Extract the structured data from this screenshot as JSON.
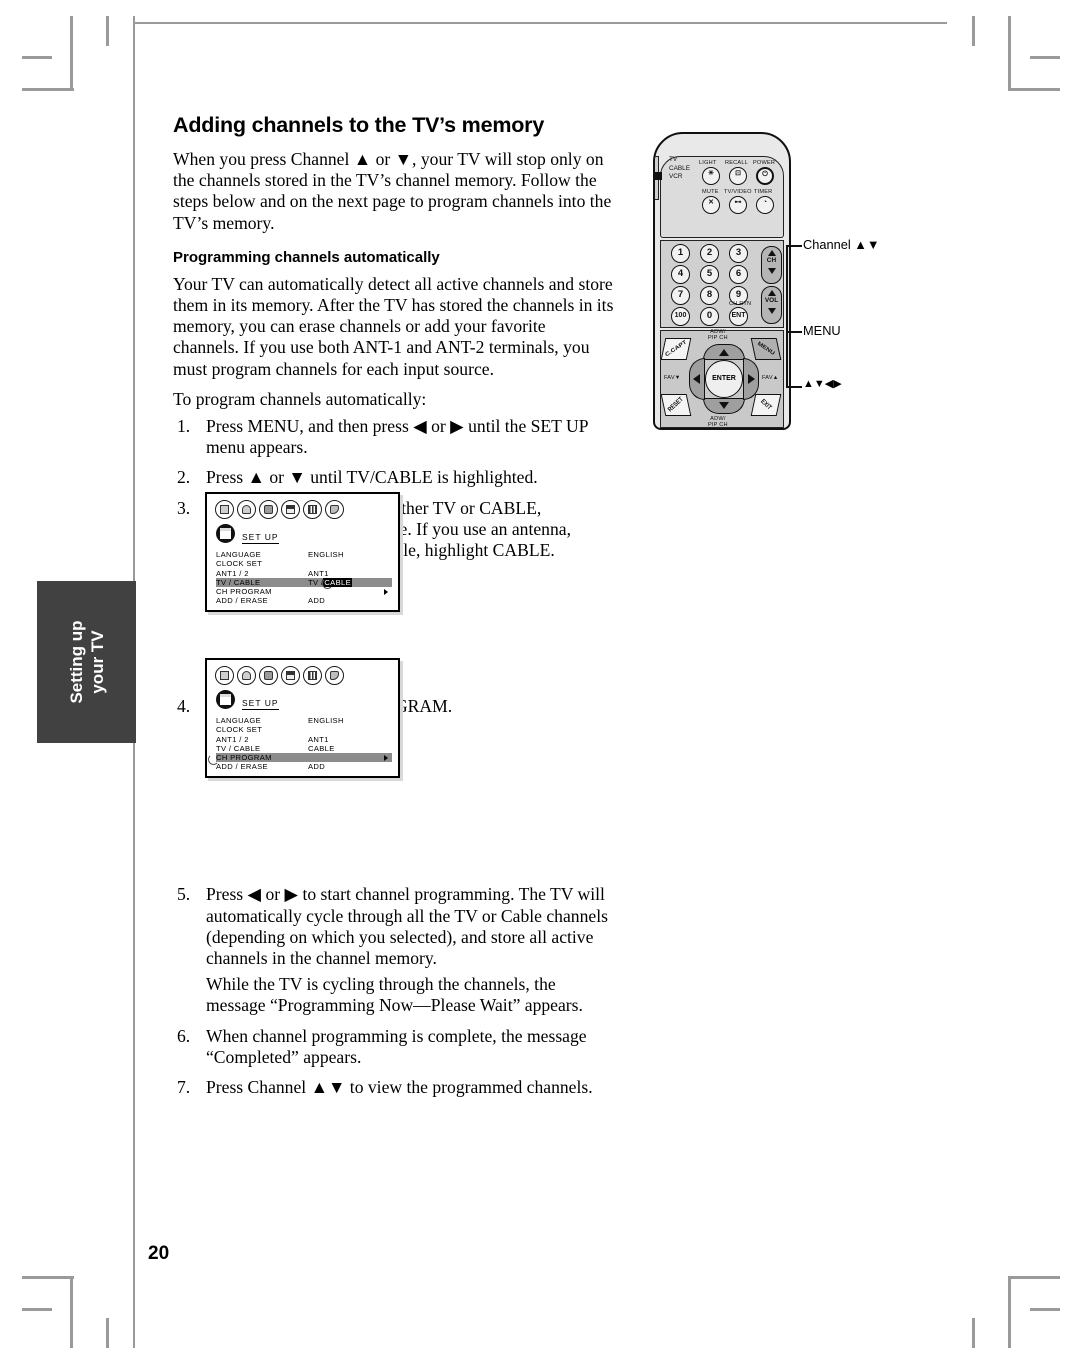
{
  "page": {
    "number": "20",
    "side_tab": "Setting up\nyour TV",
    "side_tab_line1": "Setting up",
    "side_tab_line2": "your TV"
  },
  "content": {
    "title": "Adding channels to the TV’s memory",
    "intro": "When you press Channel ▲ or ▼, your TV will stop only on the channels stored in the TV’s channel memory. Follow the steps below and on the next page to program channels into the TV’s memory.",
    "subtitle": "Programming channels automatically",
    "paragraph": "Your TV can automatically detect all active channels and store them in its memory. After the TV has stored the channels in its memory, you can erase channels or add your favorite channels. If you use both ANT-1 and ANT-2 terminals, you must program channels for each input source.",
    "lead_in": "To program channels automatically:",
    "steps": [
      {
        "num": "1.",
        "text": "Press MENU, and then press ◀ or ▶ until the SET UP menu appears."
      },
      {
        "num": "2.",
        "text": "Press ▲ or ▼ until TV/CABLE is highlighted."
      },
      {
        "num": "3.",
        "text": "Press ◀ or ▶ to highlight either TV or CABLE, depending on which you use. If you use an antenna, highlight TV; if you use cable, highlight CABLE."
      },
      {
        "num": "4.",
        "text": "Press ▼ to select CH PROGRAM."
      },
      {
        "num": "5.",
        "text": "Press ◀ or ▶ to start channel programming. The TV will automatically cycle through all the TV or Cable channels (depending on which you selected), and store all active channels in the channel memory.",
        "continuation": "While the TV is cycling through the channels, the message “Programming Now—Please Wait” appears."
      },
      {
        "num": "6.",
        "text": "When channel programming is complete, the message “Completed” appears."
      },
      {
        "num": "7.",
        "text": "Press Channel ▲▼ to view the programmed channels."
      }
    ]
  },
  "menu_screen_1": {
    "category_label": "SET UP",
    "rows": [
      {
        "label": "LANGUAGE",
        "value": "ENGLISH",
        "highlighted": false,
        "value_inverted": false
      },
      {
        "label": "CLOCK  SET",
        "value": "",
        "highlighted": false,
        "value_inverted": false
      },
      {
        "label": "ANT1 / 2",
        "value": "ANT1",
        "highlighted": false,
        "value_inverted": false
      },
      {
        "label": "TV / CABLE",
        "value": "TV /",
        "value_highlight": "CABLE",
        "highlighted": true,
        "value_inverted": true
      },
      {
        "label": "CH  PROGRAM",
        "value": "",
        "highlighted": false,
        "value_inverted": false,
        "arrow": true
      },
      {
        "label": "ADD / ERASE",
        "value": "ADD",
        "highlighted": false,
        "value_inverted": false
      }
    ]
  },
  "menu_screen_2": {
    "category_label": "SET UP",
    "rows": [
      {
        "label": "LANGUAGE",
        "value": "ENGLISH",
        "highlighted": false
      },
      {
        "label": "CLOCK  SET",
        "value": "",
        "highlighted": false
      },
      {
        "label": "ANT1 / 2",
        "value": "ANT1",
        "highlighted": false
      },
      {
        "label": "TV / CABLE",
        "value": "CABLE",
        "highlighted": false
      },
      {
        "label": "CH  PROGRAM",
        "value": "",
        "highlighted": true,
        "arrow": true
      },
      {
        "label": "ADD / ERASE",
        "value": "ADD",
        "highlighted": false
      }
    ]
  },
  "remote": {
    "mode_switch": {
      "options": [
        "TV",
        "CABLE",
        "VCR"
      ]
    },
    "top_buttons": [
      {
        "label": "LIGHT",
        "glyph": "☀"
      },
      {
        "label": "RECALL",
        "glyph": "↵"
      },
      {
        "label": "POWER",
        "glyph": "⏻"
      },
      {
        "label": "MUTE",
        "glyph": "✗"
      },
      {
        "label": "TV/VIDEO",
        "glyph": "→"
      },
      {
        "label": "TIMER",
        "glyph": "◴"
      }
    ],
    "number_keys": [
      "1",
      "2",
      "3",
      "4",
      "5",
      "6",
      "7",
      "8",
      "9",
      "100",
      "0",
      "ENT"
    ],
    "ent_label": "CH RTN",
    "ch_rocker": "CH",
    "vol_rocker": "VOL",
    "dpad": {
      "enter": "ENTER",
      "top_label": "ADW/\nPIP CH",
      "bottom_label": "ADW/\nPIP CH",
      "left_label": "FAV▼",
      "right_label": "FAV▲"
    },
    "corner_buttons": [
      {
        "name": "C.CAPT",
        "label": "C.CAPT"
      },
      {
        "name": "MENU",
        "label": "MENU"
      },
      {
        "name": "RESET",
        "label": "RESET"
      },
      {
        "name": "EXIT",
        "label": "EXIT"
      }
    ]
  },
  "callouts": [
    {
      "id": "channel",
      "label": "Channel ▲▼"
    },
    {
      "id": "menu",
      "label": "MENU"
    },
    {
      "id": "arrowpad",
      "label": "▲▼◀▶"
    }
  ]
}
